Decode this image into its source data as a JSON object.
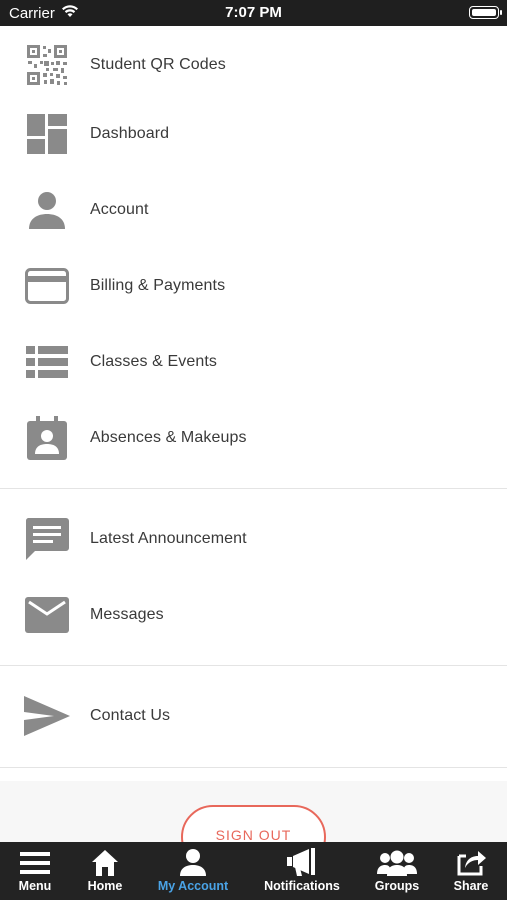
{
  "status_bar": {
    "carrier": "Carrier",
    "time": "7:07 PM"
  },
  "menu": {
    "items": [
      {
        "label": "Student QR Codes",
        "icon": "qr-code-icon"
      },
      {
        "label": "Dashboard",
        "icon": "dashboard-icon"
      },
      {
        "label": "Account",
        "icon": "person-icon"
      },
      {
        "label": "Billing & Payments",
        "icon": "credit-card-icon"
      },
      {
        "label": "Classes & Events",
        "icon": "list-icon"
      },
      {
        "label": "Absences & Makeups",
        "icon": "calendar-person-icon"
      },
      {
        "label": "Latest Announcement",
        "icon": "chat-bubble-icon"
      },
      {
        "label": "Messages",
        "icon": "envelope-icon"
      },
      {
        "label": "Contact Us",
        "icon": "send-icon"
      }
    ],
    "signout_label": "SIGN OUT"
  },
  "tab_bar": {
    "tabs": [
      {
        "label": "Menu",
        "icon": "hamburger-icon"
      },
      {
        "label": "Home",
        "icon": "home-icon"
      },
      {
        "label": "My Account",
        "icon": "account-icon"
      },
      {
        "label": "Notifications",
        "icon": "megaphone-icon"
      },
      {
        "label": "Groups",
        "icon": "groups-icon"
      },
      {
        "label": "Share",
        "icon": "share-icon"
      }
    ],
    "active_tab": "My Account"
  },
  "colors": {
    "icon_gray": "#8a8a8a",
    "tab_bar_bg": "#232323",
    "active_tab": "#4aa3e6",
    "signout_accent": "#e8685b"
  }
}
